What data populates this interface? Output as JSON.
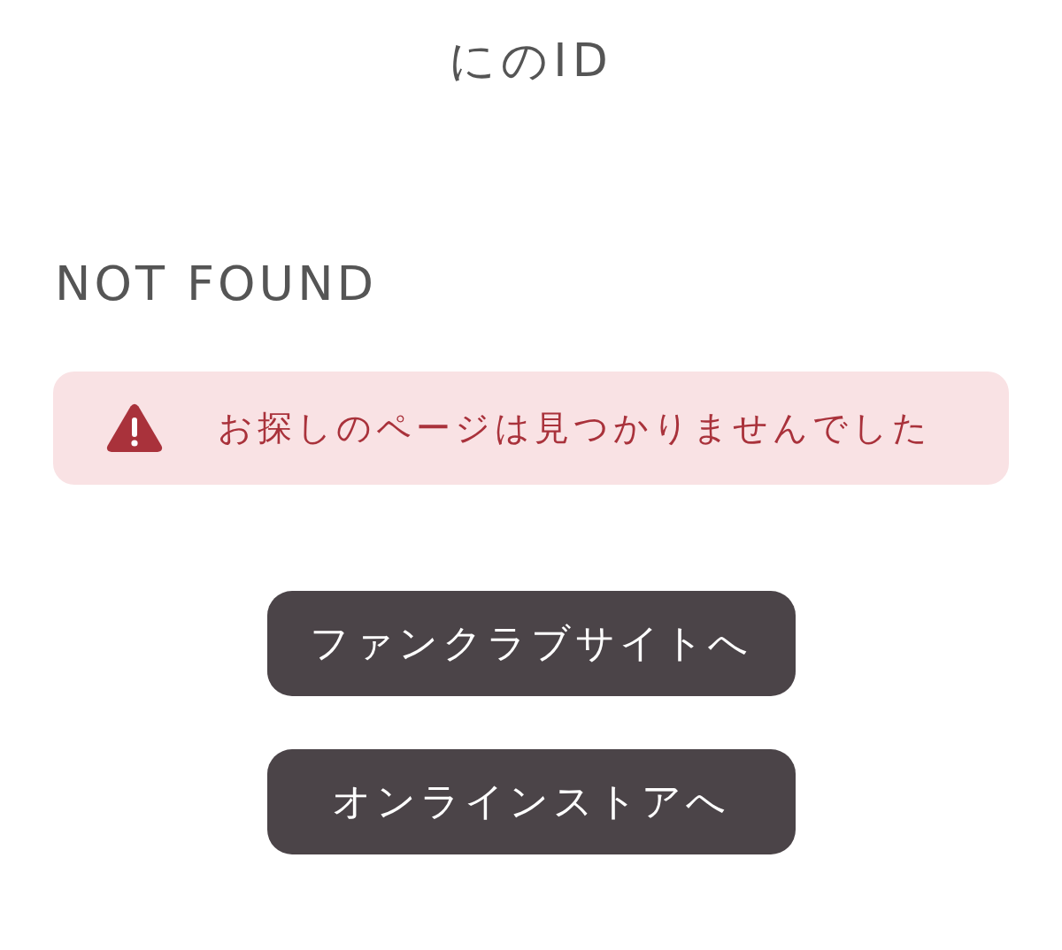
{
  "header": {
    "title": "にのID"
  },
  "heading": "NOT FOUND",
  "alert": {
    "kind": "danger",
    "message": "お探しのページは見つかりませんでした"
  },
  "buttons": [
    {
      "label": "ファンクラブサイトへ"
    },
    {
      "label": "オンラインストアへ"
    }
  ]
}
